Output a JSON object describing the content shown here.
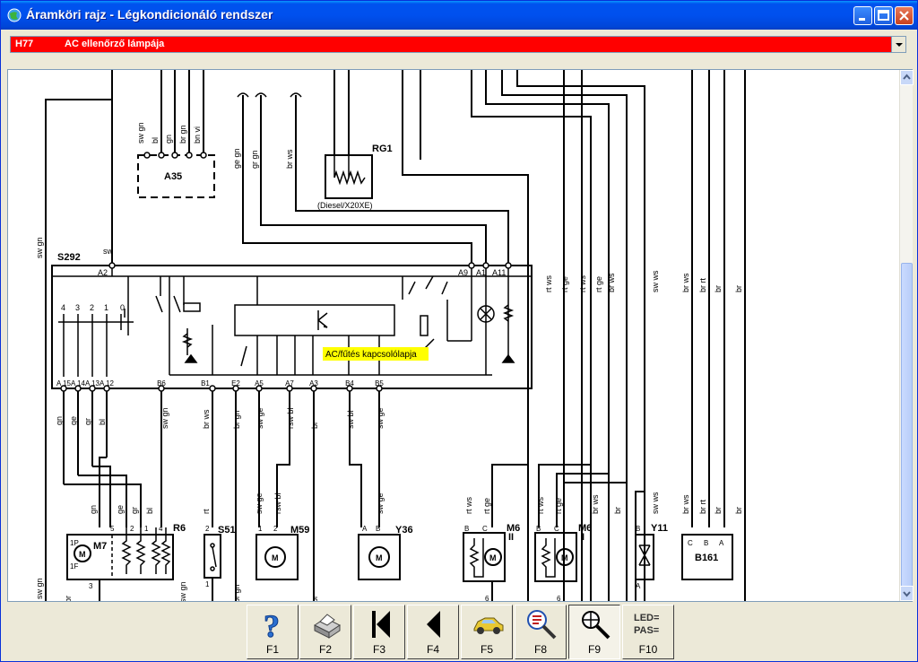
{
  "window": {
    "title": "Áramköri rajz - Légkondicionáló rendszer"
  },
  "selector": {
    "code": "H77",
    "text": "AC ellenőrző lámpája"
  },
  "diagram": {
    "components": {
      "a35": "A35",
      "rg1": "RG1",
      "rg1_note": "(Diesel/X20XE)",
      "s292": "S292",
      "r6": "R6",
      "m7": "M7",
      "s51": "S51",
      "m59": "M59",
      "y36": "Y36",
      "m6_ii": "M6",
      "m6_ii_sub": "II",
      "m6_i": "M6",
      "m6_i_sub": "I",
      "y11": "Y11",
      "b161": "B161"
    },
    "highlight_label": "AC/fűtés kapcsolólapja",
    "top_wires_a35": [
      "sw gn",
      "bl",
      "gn",
      "br gn",
      "bn vi"
    ],
    "wire_labels_upper": [
      "ge gn",
      "gr gn",
      "br ws"
    ],
    "wire_labels_right_upper": [
      "rt ws",
      "rt ge",
      "rt ws",
      "rt ge",
      "br ws",
      "sw ws",
      "br ws",
      "br rt",
      "br",
      "br"
    ],
    "wire_left": "sw gn",
    "wire_s292_top": "sw",
    "pins_top": [
      "A2",
      "A9",
      "A1",
      "A11"
    ],
    "pins_bottom": [
      "A 15",
      "A 14",
      "A 13",
      "A 12",
      "B6",
      "B1",
      "E2",
      "A5",
      "A7",
      "A3",
      "B4",
      "B5"
    ],
    "switch_positions": [
      "4",
      "3",
      "2",
      "1",
      "0"
    ],
    "wire_labels_lower": [
      "gn",
      "ge",
      "gr",
      "bl",
      "sw gn",
      "br ws",
      "br gn",
      "sw ge",
      "rsw bl",
      "br",
      "sw bl",
      "sw ge"
    ],
    "wire_labels_bottom": [
      "sw gn",
      "gn",
      "ge",
      "gr",
      "bl",
      "rt",
      "sw ge",
      "rsw bl",
      "sw ge",
      "rt ws",
      "rt ge",
      "rt ws",
      "rt ge",
      "br ws",
      "br",
      "sw ws",
      "br ws",
      "br rt",
      "br",
      "br"
    ],
    "bottom_edge_labels": [
      "sw gn",
      "br",
      "sw gn",
      "br gn",
      "br"
    ],
    "pin_letters": [
      "B",
      "C",
      "A",
      "B",
      "C",
      "B",
      "A",
      "C",
      "B",
      "A",
      "1",
      "2",
      "1",
      "2",
      "A",
      "B",
      "5",
      "2",
      "1",
      "4",
      "1P",
      "1F",
      "3",
      "6",
      "6"
    ],
    "motor_letter": "M"
  },
  "toolbar": {
    "buttons": [
      {
        "key": "F1",
        "icon": "help-icon"
      },
      {
        "key": "F2",
        "icon": "printer-icon"
      },
      {
        "key": "F3",
        "icon": "first-page-icon"
      },
      {
        "key": "F4",
        "icon": "previous-page-icon"
      },
      {
        "key": "F5",
        "icon": "car-icon"
      },
      {
        "key": "F8",
        "icon": "search-icon"
      },
      {
        "key": "F9",
        "icon": "zoom-icon"
      },
      {
        "key": "F10",
        "icon": "led-pass-icon",
        "icon_text_1": "LED=",
        "icon_text_2": "PAS="
      }
    ]
  },
  "colors": {
    "title_bar": "#0054e3",
    "selector_background": "#ff0000",
    "highlight": "#ffff66"
  }
}
